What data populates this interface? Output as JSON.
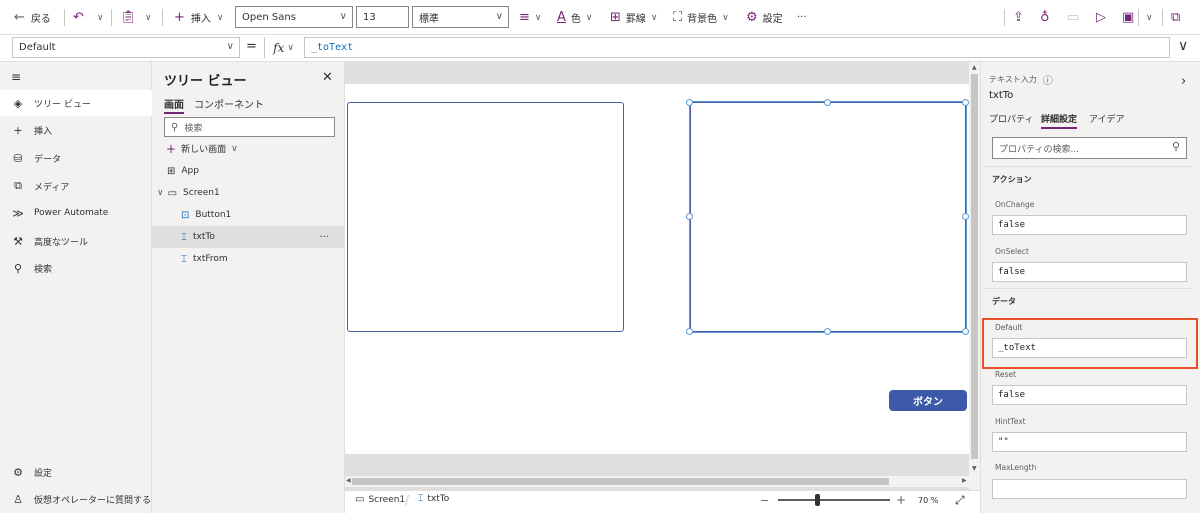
{
  "toolbar": {
    "back": "戻る",
    "insert": "挿入",
    "font": "Open Sans",
    "size": "13",
    "weight": "標準",
    "text_color": "色",
    "border": "罫線",
    "fill": "背景色",
    "settings": "設定",
    "more": "···"
  },
  "formula": {
    "property": "Default",
    "eq": "=",
    "fx": "fx",
    "value": "_toText"
  },
  "leftnav": {
    "items": [
      {
        "label": "ツリー ビュー",
        "icon": "layers-icon"
      },
      {
        "label": "挿入",
        "icon": "plus-icon"
      },
      {
        "label": "データ",
        "icon": "database-icon"
      },
      {
        "label": "メディア",
        "icon": "media-icon"
      },
      {
        "label": "Power Automate",
        "icon": "power-automate-icon"
      },
      {
        "label": "高度なツール",
        "icon": "tools-icon"
      },
      {
        "label": "検索",
        "icon": "search-icon"
      }
    ],
    "bottom": [
      {
        "label": "設定",
        "icon": "gear-icon"
      },
      {
        "label": "仮想オペレーターに質問する",
        "icon": "agent-icon"
      }
    ]
  },
  "tree": {
    "title": "ツリー ビュー",
    "tabs": [
      "画面",
      "コンポーネント"
    ],
    "search_placeholder": "検索",
    "new_screen": "新しい画面",
    "nodes": [
      "App",
      "Screen1",
      "Button1",
      "txtTo",
      "txtFrom"
    ],
    "more": "···"
  },
  "canvas": {
    "button_label": "ボタン"
  },
  "status": {
    "crumb_screen": "Screen1",
    "crumb_control": "txtTo",
    "zoom": "70 %"
  },
  "props": {
    "type": "テキスト入力",
    "name": "txtTo",
    "tabs": [
      "プロパティ",
      "詳細設定",
      "アイデア"
    ],
    "search_placeholder": "プロパティの検索...",
    "section_action": "アクション",
    "section_data": "データ",
    "fields": [
      {
        "label": "OnChange",
        "value": "false"
      },
      {
        "label": "OnSelect",
        "value": "false"
      },
      {
        "label": "Default",
        "value": "_toText"
      },
      {
        "label": "Reset",
        "value": "false"
      },
      {
        "label": "HintText",
        "value": "\"\""
      },
      {
        "label": "MaxLength",
        "value": ""
      }
    ]
  },
  "colors": {
    "accent": "#742774",
    "control_border": "#4a5eaa",
    "button": "#3d5aa8",
    "highlight": "#e8502a"
  }
}
